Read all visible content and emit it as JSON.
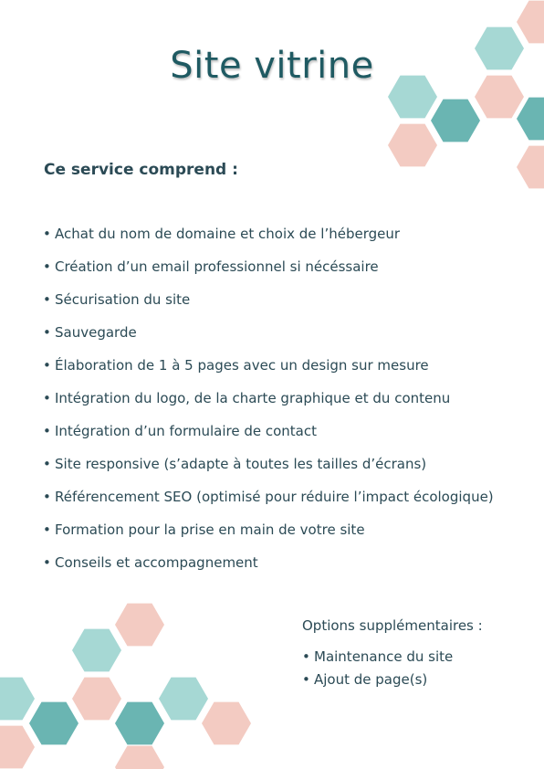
{
  "page": {
    "title": "Site vitrine",
    "intro": "Ce service comprend :",
    "bullet": "•",
    "services": [
      "Achat du nom de domaine et choix de l’hébergeur",
      "Création d’un email professionnel si nécéssaire",
      "Sécurisation du site",
      "Sauvegarde",
      "Élaboration de 1 à 5 pages avec un design sur mesure",
      "Intégration du logo,  de la charte graphique et du contenu",
      "Intégration d’un formulaire de contact",
      "Site responsive (s’adapte à toutes les tailles d’écrans)",
      "Référencement SEO (optimisé pour réduire l’impact écologique)",
      "Formation pour la prise en main de votre site",
      "Conseils et accompagnement"
    ],
    "options_title": "Options supplémentaires :",
    "options": [
      "Maintenance du site",
      "Ajout de page(s)"
    ]
  },
  "colors": {
    "title": "#1f5a62",
    "text": "#2b4a55",
    "hex_light_teal": "#a6d8d4",
    "hex_teal": "#6ab5b2",
    "hex_pink": "#f3cbc2"
  }
}
